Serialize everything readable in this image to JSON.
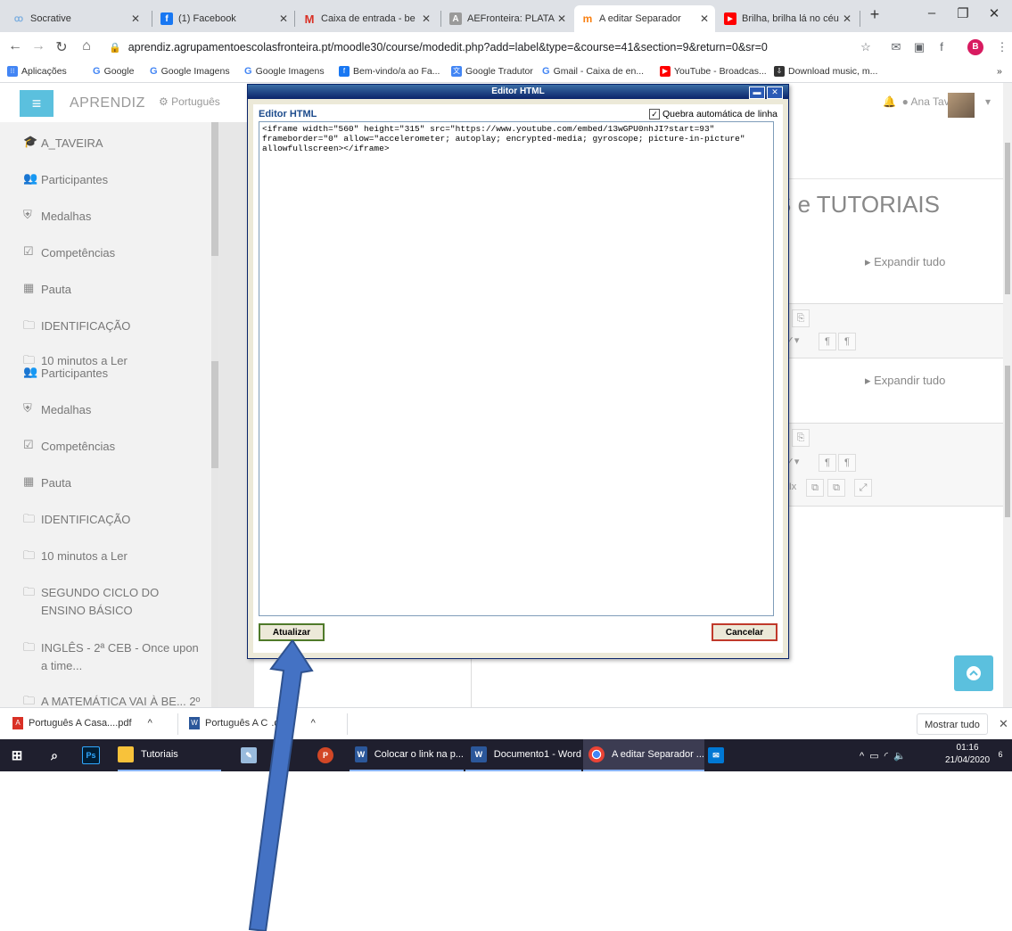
{
  "browser": {
    "tabs": [
      {
        "title": "Socrative",
        "icon": "socrative-icon",
        "icon_color": "#7fb0e0"
      },
      {
        "title": "(1) Facebook",
        "icon": "facebook-icon",
        "icon_color": "#1877f2"
      },
      {
        "title": "Caixa de entrada - be",
        "icon": "gmail-icon",
        "icon_color": "#d93025"
      },
      {
        "title": "AEFronteira: PLATAFOR",
        "icon": "aefronteira-icon",
        "icon_color": "#8a8a8a"
      },
      {
        "title": "A editar Separador",
        "icon": "moodle-icon",
        "icon_color": "#f98012"
      },
      {
        "title": "Brilha, brilha lá no céu",
        "icon": "youtube-icon",
        "icon_color": "#ff0000"
      }
    ],
    "active_tab_index": 4,
    "new_tab_symbol": "+",
    "window_controls": {
      "minimize": "–",
      "restore": "❐",
      "close": "✕"
    },
    "url": "aprendiz.agrupamentoescolasfronteira.pt/moodle30/course/modedit.php?add=label&type=&course=41&section=9&return=0&sr=0",
    "profile_letter": "B",
    "bookmarks": [
      {
        "label": "Aplicações",
        "icon": "apps-icon"
      },
      {
        "label": "Google",
        "icon": "google-icon"
      },
      {
        "label": "Google Imagens",
        "icon": "google-icon"
      },
      {
        "label": "Google Imagens",
        "icon": "google-icon"
      },
      {
        "label": "Bem-vindo/a ao Fa...",
        "icon": "facebook-icon"
      },
      {
        "label": "Google Tradutor",
        "icon": "translate-icon"
      },
      {
        "label": "Gmail - Caixa de en...",
        "icon": "google-icon"
      },
      {
        "label": "YouTube - Broadcas...",
        "icon": "youtube-icon"
      },
      {
        "label": "Download music, m...",
        "icon": "download-icon"
      }
    ],
    "bookmarks_overflow": "»"
  },
  "moodle": {
    "site_name": "APRENDIZ",
    "language": "Português",
    "user_name": "Ana Taveira",
    "background_title": "S e TUTORIAIS",
    "expand_all": "Expandir tudo",
    "sidebar_items": [
      {
        "label": "A_TAVEIRA",
        "icon": "graduation-cap-icon",
        "glyph": "🎓"
      },
      {
        "label": "Participantes",
        "icon": "users-icon",
        "glyph": "👥"
      },
      {
        "label": "Medalhas",
        "icon": "shield-icon",
        "glyph": "⛨"
      },
      {
        "label": "Competências",
        "icon": "checkbox-icon",
        "glyph": "☑"
      },
      {
        "label": "Pauta",
        "icon": "grid-icon",
        "glyph": "▦"
      },
      {
        "label": "IDENTIFICAÇÃO",
        "icon": "folder-icon",
        "glyph": "🗀"
      },
      {
        "label": "10 minutos a Ler",
        "icon": "folder-icon",
        "glyph": "🗀"
      },
      {
        "label": "Participantes",
        "icon": "users-icon",
        "glyph": "👥"
      },
      {
        "label": "Medalhas",
        "icon": "shield-icon",
        "glyph": "⛨"
      },
      {
        "label": "Competências",
        "icon": "checkbox-icon",
        "glyph": "☑"
      },
      {
        "label": "Pauta",
        "icon": "grid-icon",
        "glyph": "▦"
      },
      {
        "label": "IDENTIFICAÇÃO",
        "icon": "folder-icon",
        "glyph": "🗀"
      },
      {
        "label": "10 minutos a Ler",
        "icon": "folder-icon",
        "glyph": "🗀"
      },
      {
        "label": "SEGUNDO CICLO DO\nENSINO BÁSICO",
        "icon": "folder-icon",
        "glyph": "🗀"
      },
      {
        "label": "INGLÊS - 2ª CEB - Once upon\na time...",
        "icon": "folder-icon",
        "glyph": "🗀"
      },
      {
        "label": "A MATEMÁTICA VAI À BE... 2º",
        "icon": "folder-icon",
        "glyph": "🗀"
      }
    ]
  },
  "dialog": {
    "window_title": "Editor HTML",
    "label": "Editor HTML",
    "wrap_option": "Quebra automática de linha",
    "wrap_checked": true,
    "code": "<iframe width=\"560\" height=\"315\" src=\"https://www.youtube.com/embed/13wGPU0nhJI?start=93\"\nframeborder=\"0\" allow=\"accelerometer; autoplay; encrypted-media; gyroscope; picture-in-picture\"\nallowfullscreen></iframe>",
    "update_button": "Atualizar",
    "cancel_button": "Cancelar"
  },
  "downloads": {
    "items": [
      {
        "label": "Português A Casa....pdf",
        "icon": "pdf-icon",
        "color": "#d93025"
      },
      {
        "label": "Português A C",
        "icon": "word-icon",
        "color": "#2b579a"
      }
    ],
    "chevron": "^",
    "show_all": "Mostrar tudo",
    "close": "✕"
  },
  "taskbar": {
    "items": [
      {
        "label": "",
        "icon": "windows-icon"
      },
      {
        "label": "",
        "icon": "search-icon"
      },
      {
        "label": "",
        "icon": "photoshop-icon"
      },
      {
        "label": "Tutoriais",
        "icon": "folder-icon"
      },
      {
        "label": "",
        "icon": "paint-icon"
      },
      {
        "label": "",
        "icon": "excel-icon"
      },
      {
        "label": "",
        "icon": "powerpoint-icon"
      },
      {
        "label": "Colocar o link na p...",
        "icon": "word-icon"
      },
      {
        "label": "Documento1 - Word",
        "icon": "word-icon"
      },
      {
        "label": "A editar Separador ...",
        "icon": "chrome-icon"
      },
      {
        "label": "",
        "icon": "mail-icon"
      }
    ],
    "time": "01:16",
    "date": "21/04/2020",
    "notification_count": "6"
  },
  "colors": {
    "moodle_accent": "#5bc0de",
    "taskbar_bg": "#1f1f2e",
    "dialog_title_bg": "#0a246a"
  }
}
